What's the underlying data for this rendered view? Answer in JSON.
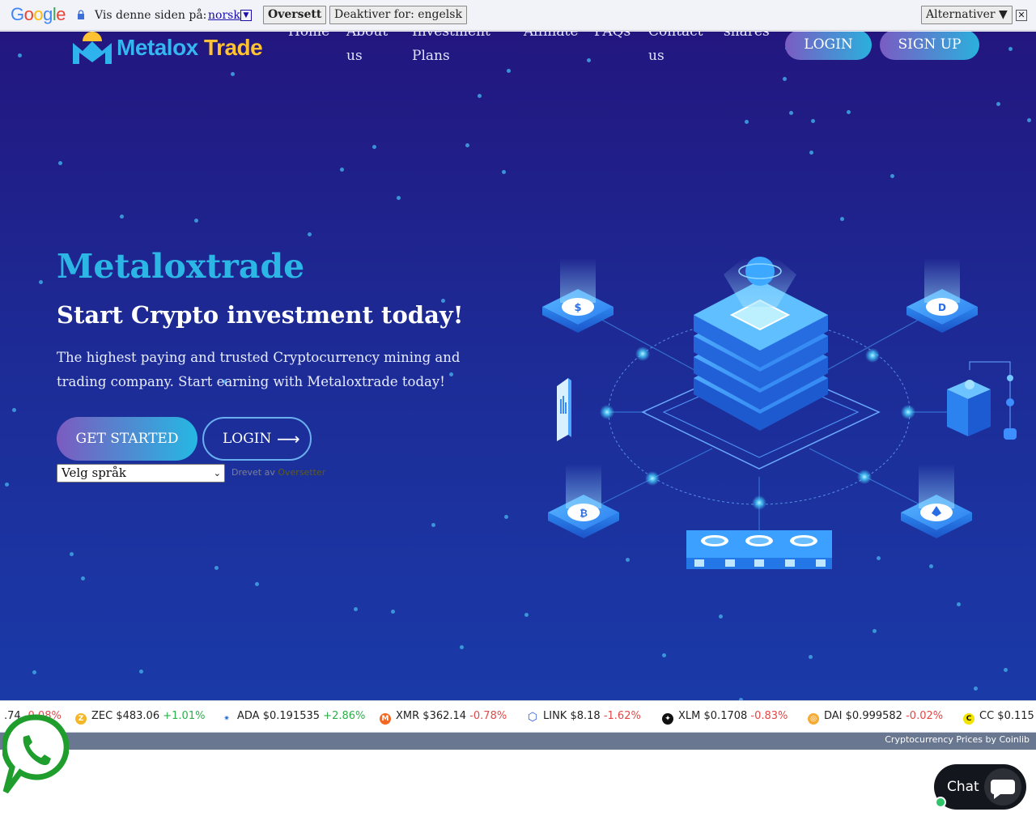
{
  "translate_bar": {
    "brand": "Google",
    "label": "Vis denne siden på:",
    "language": "norsk",
    "translate_button": "Oversett",
    "disable_button": "Deaktiver for: engelsk",
    "options_button": "Alternativer ▼",
    "close_glyph": "✕"
  },
  "header": {
    "logo_part1": "Metalox",
    "logo_part2": "Trade",
    "nav": [
      {
        "line1": "Home",
        "line2": ""
      },
      {
        "line1": "About",
        "line2": "us"
      },
      {
        "line1": "Investment",
        "line2": "Plans"
      },
      {
        "line1": "Affiliate",
        "line2": ""
      },
      {
        "line1": "FAQs",
        "line2": ""
      },
      {
        "line1": "Contact",
        "line2": "us"
      },
      {
        "line1": "shares",
        "line2": ""
      }
    ],
    "login_label": "LOGIN",
    "signup_label": "SIGN UP"
  },
  "hero": {
    "title": "Metaloxtrade",
    "subtitle": "Start Crypto investment today!",
    "description": "The highest paying and trusted Cryptocurrency mining and trading company. Start earning with Metaloxtrade today!",
    "cta_primary": "GET STARTED",
    "cta_secondary": "LOGIN",
    "cta_secondary_arrow": "⟶",
    "language_select": "Velg språk",
    "powered_prefix": "Drevet av",
    "powered_brand": "Oversetter"
  },
  "ticker": {
    "items": [
      {
        "symbol": "",
        "price": ".74",
        "change": "-0.08%",
        "dir": "down",
        "color": "#888888",
        "glyph": ""
      },
      {
        "symbol": "ZEC",
        "price": "$483.06",
        "change": "+1.01%",
        "dir": "up",
        "color": "#f4b728",
        "glyph": "Z"
      },
      {
        "symbol": "ADA",
        "price": "$0.191535",
        "change": "+2.86%",
        "dir": "up",
        "color": "#2a71d0",
        "glyph": "✷"
      },
      {
        "symbol": "XMR",
        "price": "$362.14",
        "change": "-0.78%",
        "dir": "down",
        "color": "#f26822",
        "glyph": "M"
      },
      {
        "symbol": "LINK",
        "price": "$8.18",
        "change": "-1.62%",
        "dir": "down",
        "color": "#2a5ada",
        "glyph": "⬡"
      },
      {
        "symbol": "XLM",
        "price": "$0.1708",
        "change": "-0.83%",
        "dir": "down",
        "color": "#111111",
        "glyph": "✦"
      },
      {
        "symbol": "DAI",
        "price": "$0.999582",
        "change": "-0.02%",
        "dir": "down",
        "color": "#f5ac37",
        "glyph": "◎"
      },
      {
        "symbol": "CC",
        "price": "$0.115",
        "change": "",
        "dir": "up",
        "color": "#f2e300",
        "glyph": "C"
      }
    ],
    "credit": "Cryptocurrency Prices by Coinlib"
  },
  "chat_widget": {
    "label": "Chat"
  }
}
